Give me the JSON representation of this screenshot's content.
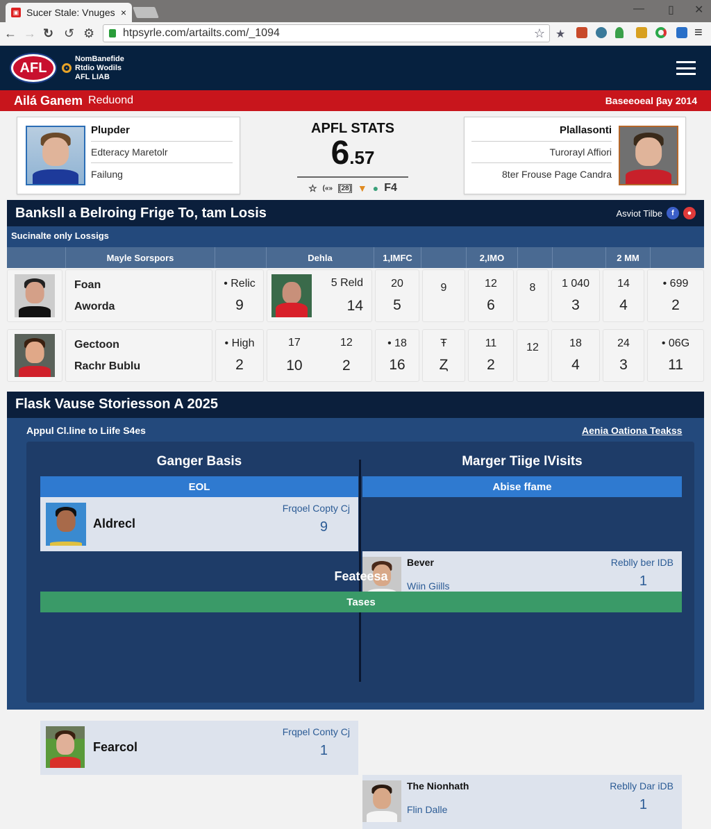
{
  "browser": {
    "tab_title": "Sucer Stale: Vnuges",
    "tab_close": "×",
    "url": "htpsyrle.com/artailts.com/_1094",
    "window_controls": [
      "—",
      "▯",
      "✕"
    ],
    "nav_icons": [
      "back-icon",
      "forward-icon",
      "reload-icon",
      "refresh-alt-icon",
      "settings-icon"
    ],
    "extension_icons": [
      "pin-icon",
      "calendar-icon",
      "globe-icon",
      "person-icon",
      "trophy-icon",
      "chrome-icon",
      "translate-icon",
      "menu-icon"
    ]
  },
  "site": {
    "logo_text": "AFL",
    "brand_lines": [
      "NomBanefide",
      "Rtdio Wodils",
      "AFL LIAB"
    ],
    "redbar": {
      "title": "Ailá Ganem",
      "subtitle": "Reduond",
      "right": "Baseeoeal βay 2014"
    }
  },
  "profiles": {
    "left": {
      "name": "Plupder",
      "line2": "Edteracy Maretolr",
      "line3": "Failung"
    },
    "right": {
      "name": "Plallasonti",
      "line2": "Turorayl Affiori",
      "line3": "8ter Frouse  Page Candra"
    }
  },
  "stats": {
    "title": "APFL STATS",
    "value_main": "6",
    "value_decimal": ".57",
    "icons": [
      "☆",
      "(«»",
      "[28]",
      "▼",
      "●"
    ],
    "icon_label": "F4"
  },
  "section1": {
    "title": "Banksll a Belroing Frige To, tam Losis",
    "right_label": "Asviot Tilbe",
    "social": [
      "f",
      "●"
    ],
    "subtitle": "Sucinalte only Lossigs",
    "headers": [
      "",
      "Mayle Sorspors",
      "",
      "Dehla",
      "1,IMFC",
      "",
      "2,IMO",
      "",
      "",
      "2 MM",
      ""
    ],
    "rows": [
      {
        "name1": "Foan",
        "name2": "Aworda",
        "c1": [
          "• Relic",
          "9"
        ],
        "c2": [
          "5 Reld",
          "14"
        ],
        "c3": [
          "20",
          "5"
        ],
        "c4": [
          "9",
          ""
        ],
        "c5": [
          "12",
          "6"
        ],
        "c6": [
          "8",
          ""
        ],
        "c7": [
          "1 040",
          "3"
        ],
        "c8": [
          "14",
          "4"
        ],
        "c9": [
          "• 699",
          "2"
        ]
      },
      {
        "name1": "Gectoon",
        "name2": "Rachr Bublu",
        "c1": [
          "• High",
          "2"
        ],
        "c2a": [
          "17",
          "10"
        ],
        "c2b": [
          "12",
          "2"
        ],
        "c3": [
          "• 18",
          "16"
        ],
        "c4": [
          "Ŧ",
          "Ȥ"
        ],
        "c5": [
          "11",
          "2"
        ],
        "c6": [
          "12",
          ""
        ],
        "c7": [
          "18",
          "4"
        ],
        "c8": [
          "24",
          "3"
        ],
        "c9": [
          "• 06G",
          "11"
        ]
      }
    ]
  },
  "section2": {
    "title": "Flask Vause Storiesson A 2025",
    "left_link": "Appul Cl.line to Liife S4es",
    "right_link": "Aenia Oationa Teakss",
    "col_left_title": "Ganger Basis",
    "col_right_title": "Marger Tiige lVisits",
    "band1_left": "EOL",
    "band1_right": "Abise ffame",
    "feature_title": "Feateesa",
    "band2": "Tases",
    "cards": [
      {
        "name": "Aldrecl",
        "label": "Frqoel Copty Cj",
        "value": "9"
      },
      {
        "name": "Bever",
        "sub": "Wiin Giills",
        "label": "Reblly ber IDB",
        "value": "1"
      },
      {
        "name": "Fearcol",
        "label": "Frqpel Conty Cj",
        "value": "1"
      },
      {
        "name": "The Nionhath",
        "sub": "Flin Dalle",
        "label": "Reblly Dar iDB",
        "value": "1"
      }
    ]
  }
}
